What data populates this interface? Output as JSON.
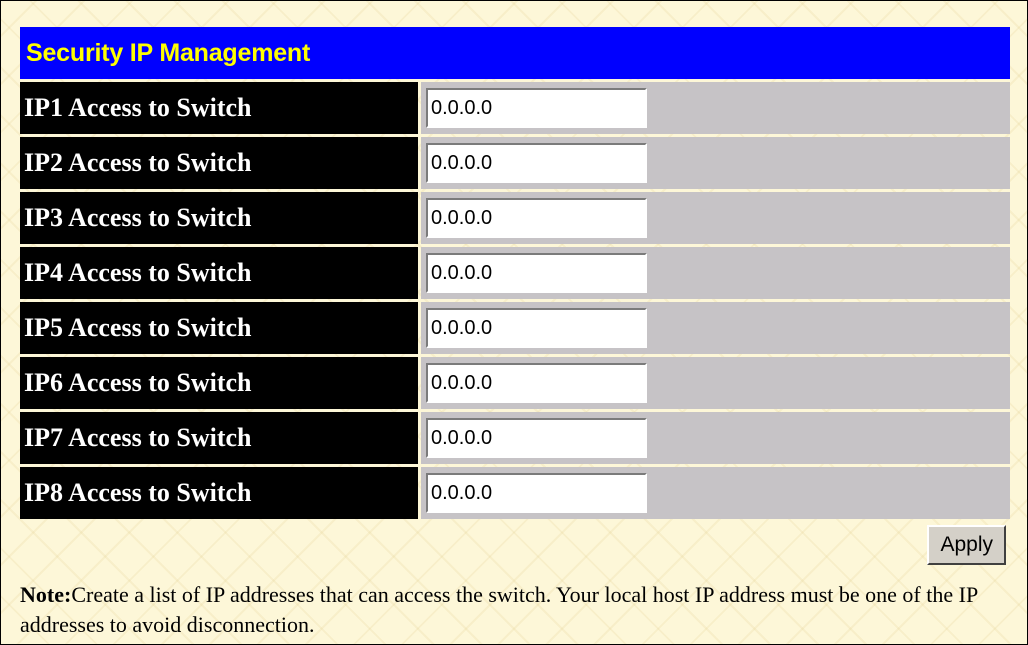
{
  "panel": {
    "title": "Security IP Management",
    "rows": [
      {
        "label": "IP1 Access to Switch",
        "value": "0.0.0.0"
      },
      {
        "label": "IP2 Access to Switch",
        "value": "0.0.0.0"
      },
      {
        "label": "IP3 Access to Switch",
        "value": "0.0.0.0"
      },
      {
        "label": "IP4 Access to Switch",
        "value": "0.0.0.0"
      },
      {
        "label": "IP5 Access to Switch",
        "value": "0.0.0.0"
      },
      {
        "label": "IP6 Access to Switch",
        "value": "0.0.0.0"
      },
      {
        "label": "IP7 Access to Switch",
        "value": "0.0.0.0"
      },
      {
        "label": "IP8 Access to Switch",
        "value": "0.0.0.0"
      }
    ],
    "apply_label": "Apply"
  },
  "note": {
    "label": "Note:",
    "text": "Create a list of IP addresses that can access the switch. Your local host IP address must be one of the IP addresses to avoid disconnection."
  },
  "colors": {
    "title_bg": "#0000ff",
    "title_text": "#ffff00",
    "label_bg": "#000000",
    "cell_bg": "#c6c3c6",
    "page_bg": "#fdf7d8"
  }
}
